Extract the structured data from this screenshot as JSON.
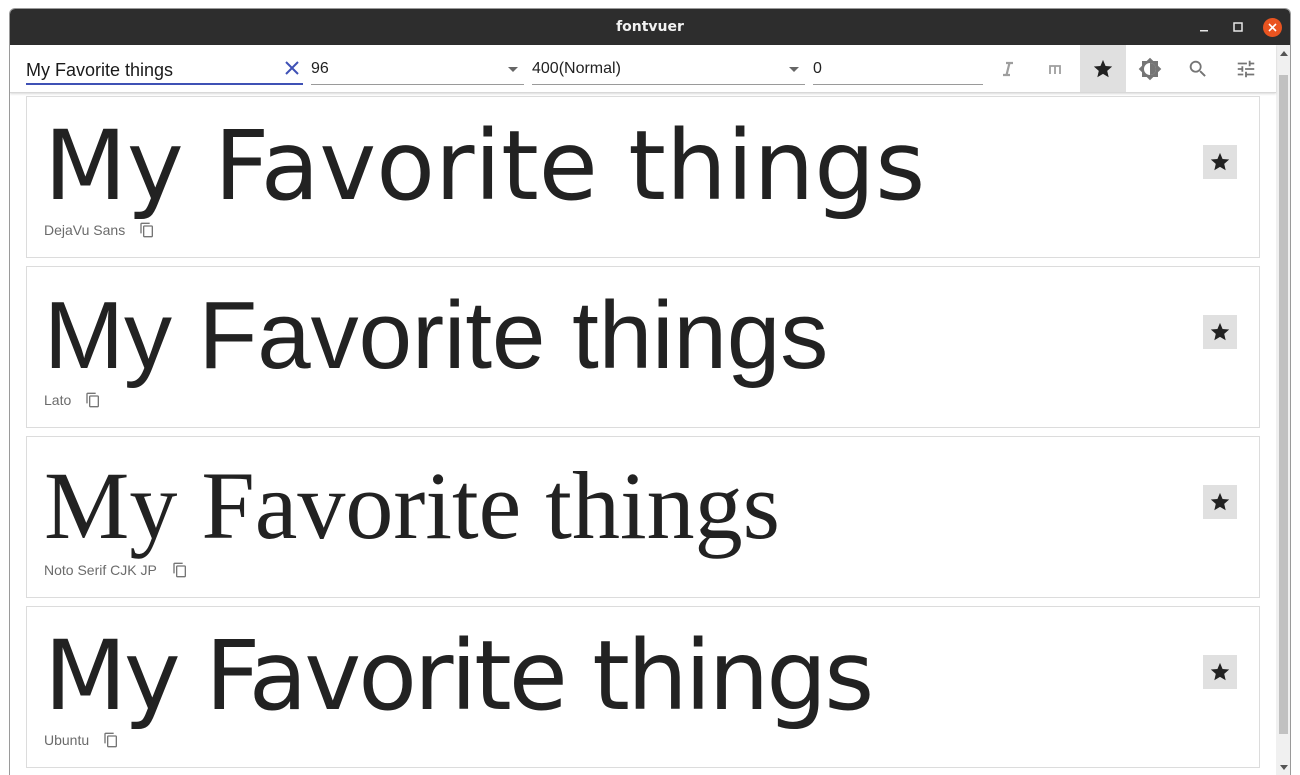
{
  "window": {
    "title": "fontvuer"
  },
  "toolbar": {
    "preview_text": "My Favorite things",
    "font_size": "96",
    "font_weight": "400(Normal)",
    "letter_spacing": "0",
    "buttons": [
      "italic-icon",
      "monospace-icon",
      "star-icon",
      "brightness-icon",
      "search-icon",
      "tune-icon"
    ],
    "active_button": "star-icon"
  },
  "fonts": [
    {
      "sample": "My Favorite things",
      "name": "DejaVu Sans",
      "favorite": true
    },
    {
      "sample": "My Favorite things",
      "name": "Lato",
      "favorite": true
    },
    {
      "sample": "My Favorite things",
      "name": "Noto Serif CJK JP",
      "favorite": true
    },
    {
      "sample": "My Favorite things",
      "name": "Ubuntu",
      "favorite": true
    }
  ],
  "colors": {
    "titlebar": "#2d2d2d",
    "close": "#e95420",
    "accent": "#3f51b5",
    "active": "#e0e0e0"
  }
}
